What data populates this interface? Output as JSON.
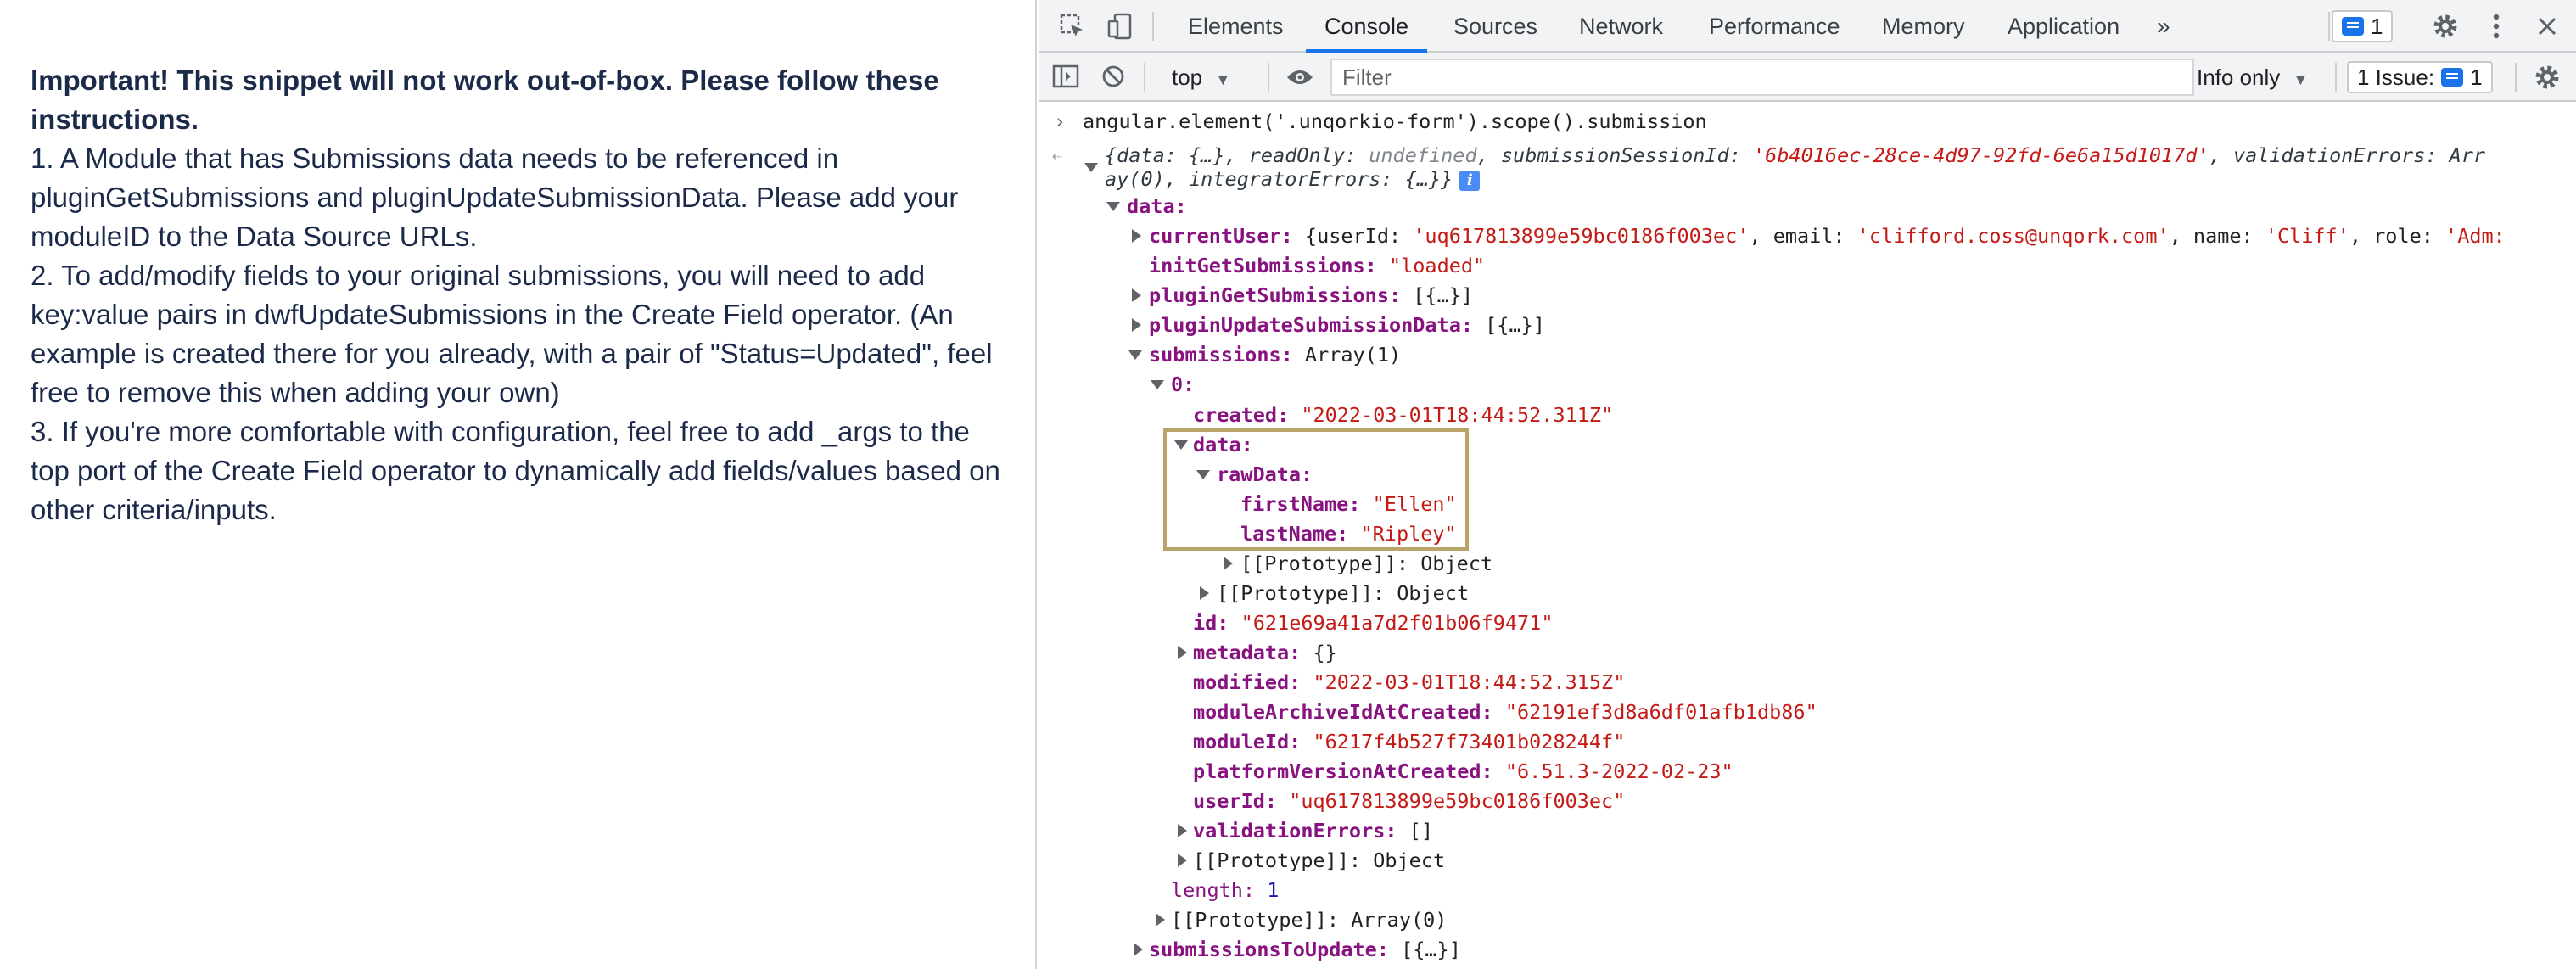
{
  "instructions": {
    "title": "Important! This snippet will not work out-of-box. Please follow these instructions.",
    "step1": "1. A Module that has Submissions data needs to be referenced in pluginGetSubmissions and pluginUpdateSubmissionData. Please add your moduleID to the Data Source URLs.",
    "step2": "2. To add/modify fields to your original submissions, you will need to add key:value pairs in dwfUpdateSubmissions in the Create Field operator. (An example is created there for you already, with a pair of \"Status=Updated\", feel free to remove this when adding your own)",
    "step3": "3. If you're more comfortable with configuration, feel free to add _args to the top port of the Create Field operator to dynamically add fields/values based on other criteria/inputs."
  },
  "devtools": {
    "tabs": [
      "Elements",
      "Console",
      "Sources",
      "Network",
      "Performance",
      "Memory",
      "Application"
    ],
    "active_tab": "Console",
    "more_tabs": "»",
    "message_count": "1",
    "context": "top",
    "filter_placeholder": "Filter",
    "filter_value": "",
    "log_levels": "Info only",
    "issues_label": "1 Issue:",
    "issues_count": "1",
    "accent_color": "#1a73e8"
  },
  "console": {
    "input": "angular.element('.unqorkio-form').scope().submission",
    "summary": {
      "line1a": "{data: {…}, readOnly: ",
      "line1b": "undefined",
      "line1c": ", submissionSessionId: ",
      "line1d": "'6b4016ec-28ce-4d97-92fd-6e6a15d1017d'",
      "line1e": ", validationErrors: Arr",
      "line2": "ay(0), integratorErrors: {…}}"
    },
    "data_key": "data:",
    "currentUser": {
      "key": "currentUser:",
      "a": " {userId: ",
      "userId": "'uq617813899e59bc0186f003ec'",
      "b": ", email: ",
      "email": "'clifford.coss@unqork.com'",
      "c": ", name: ",
      "name": "'Cliff'",
      "d": ", role: ",
      "role": "'Adm:"
    },
    "initGetSubmissions": {
      "key": "initGetSubmissions:",
      "value": "\"loaded\""
    },
    "pluginGetSubmissions": {
      "key": "pluginGetSubmissions:",
      "value": " [{…}]"
    },
    "pluginUpdateSubmissionData": {
      "key": "pluginUpdateSubmissionData:",
      "value": " [{…}]"
    },
    "submissions": {
      "key": "submissions:",
      "value": " Array(1)"
    },
    "index0": "0:",
    "created": {
      "key": "created:",
      "value": "\"2022-03-01T18:44:52.311Z\""
    },
    "inner_data_key": "data:",
    "rawData_key": "rawData:",
    "firstName": {
      "key": "firstName:",
      "value": "\"Ellen\""
    },
    "lastName": {
      "key": "lastName:",
      "value": "\"Ripley\""
    },
    "proto_object_1": "[[Prototype]]: Object",
    "proto_object_2": "[[Prototype]]: Object",
    "id": {
      "key": "id:",
      "value": "\"621e69a41a7d2f01b06f9471\""
    },
    "metadata": {
      "key": "metadata:",
      "value": " {}"
    },
    "modified": {
      "key": "modified:",
      "value": "\"2022-03-01T18:44:52.315Z\""
    },
    "moduleArchiveIdAtCreated": {
      "key": "moduleArchiveIdAtCreated:",
      "value": "\"62191ef3d8a6df01afb1db86\""
    },
    "moduleId": {
      "key": "moduleId:",
      "value": "\"6217f4b527f73401b028244f\""
    },
    "platformVersionAtCreated": {
      "key": "platformVersionAtCreated:",
      "value": "\"6.51.3-2022-02-23\""
    },
    "userId": {
      "key": "userId:",
      "value": "\"uq617813899e59bc0186f003ec\""
    },
    "validationErrors": {
      "key": "validationErrors:",
      "value": " []"
    },
    "proto_object_3": "[[Prototype]]: Object",
    "length": {
      "key": "length:",
      "value": "1"
    },
    "proto_array": "[[Prototype]]: Array(0)",
    "submissionsToUpdate": {
      "key": "submissionsToUpdate:",
      "value": " [{…}]"
    }
  }
}
